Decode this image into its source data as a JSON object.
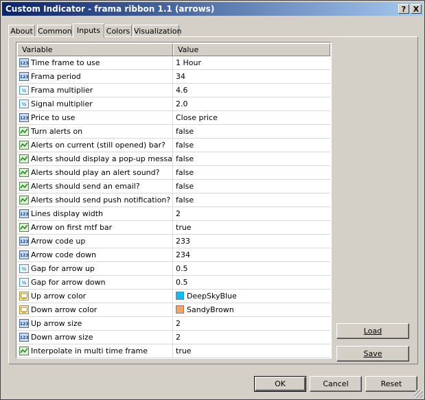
{
  "window": {
    "title": "Custom Indicator - frama ribbon 1.1 (arrows)",
    "help_label": "?",
    "close_label": "X"
  },
  "tabs": [
    {
      "label": "About"
    },
    {
      "label": "Common"
    },
    {
      "label": "Inputs",
      "active": true
    },
    {
      "label": "Colors"
    },
    {
      "label": "Visualization"
    }
  ],
  "grid": {
    "headers": {
      "variable": "Variable",
      "value": "Value"
    },
    "rows": [
      {
        "icon": "int-icon",
        "name": "Time frame to use",
        "value": "1 Hour"
      },
      {
        "icon": "int-icon",
        "name": "Frama period",
        "value": "34"
      },
      {
        "icon": "double-icon",
        "name": "Frama multiplier",
        "value": "4.6"
      },
      {
        "icon": "double-icon",
        "name": "Signal multiplier",
        "value": "2.0"
      },
      {
        "icon": "int-icon",
        "name": "Price to use",
        "value": "Close price"
      },
      {
        "icon": "bool-icon",
        "name": "Turn alerts on",
        "value": "false"
      },
      {
        "icon": "bool-icon",
        "name": "Alerts on current (still opened) bar?",
        "value": "false"
      },
      {
        "icon": "bool-icon",
        "name": "Alerts should display a pop-up message?",
        "value": "false"
      },
      {
        "icon": "bool-icon",
        "name": "Alerts should play an alert sound?",
        "value": "false"
      },
      {
        "icon": "bool-icon",
        "name": "Alerts should send an email?",
        "value": "false"
      },
      {
        "icon": "bool-icon",
        "name": "Alerts should send push notification?",
        "value": "false"
      },
      {
        "icon": "int-icon",
        "name": "Lines display width",
        "value": "2"
      },
      {
        "icon": "bool-icon",
        "name": "Arrow on first mtf bar",
        "value": "true"
      },
      {
        "icon": "int-icon",
        "name": "Arrow code up",
        "value": "233"
      },
      {
        "icon": "int-icon",
        "name": "Arrow code down",
        "value": "234"
      },
      {
        "icon": "double-icon",
        "name": "Gap for arrow up",
        "value": "0.5"
      },
      {
        "icon": "double-icon",
        "name": "Gap for arrow down",
        "value": "0.5"
      },
      {
        "icon": "color-icon",
        "name": "Up arrow color",
        "value": "DeepSkyBlue",
        "swatch": "#00bfff"
      },
      {
        "icon": "color-icon",
        "name": "Down arrow color",
        "value": "SandyBrown",
        "swatch": "#f4a460"
      },
      {
        "icon": "int-icon",
        "name": "Up arrow size",
        "value": "2"
      },
      {
        "icon": "int-icon",
        "name": "Down arrow size",
        "value": "2"
      },
      {
        "icon": "bool-icon",
        "name": "Interpolate in multi time frame",
        "value": "true"
      }
    ]
  },
  "side_buttons": {
    "load": "Load",
    "save": "Save"
  },
  "footer": {
    "ok": "OK",
    "cancel": "Cancel",
    "reset": "Reset"
  },
  "colors": {
    "title_start": "#0a246a",
    "title_end": "#a6caf0",
    "face": "#d4d0c8"
  }
}
